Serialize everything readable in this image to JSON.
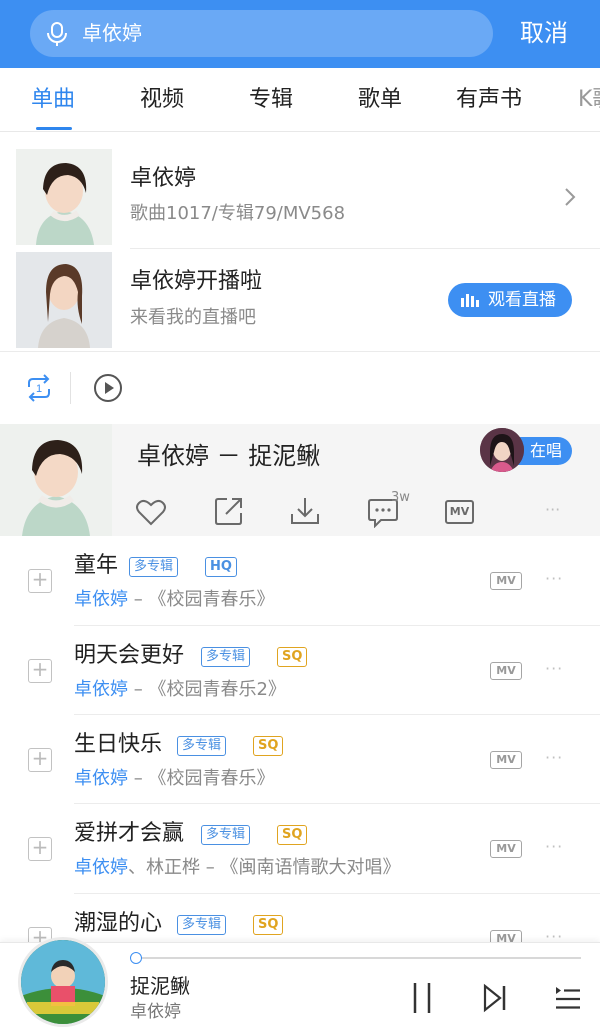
{
  "search": {
    "query": "卓依婷",
    "cancel_label": "取消"
  },
  "tabs": [
    {
      "label": "单曲",
      "active": true
    },
    {
      "label": "视频",
      "active": false
    },
    {
      "label": "专辑",
      "active": false
    },
    {
      "label": "歌单",
      "active": false
    },
    {
      "label": "有声书",
      "active": false
    },
    {
      "label": "K歌",
      "active": false
    }
  ],
  "artist_card": {
    "name": "卓依婷",
    "stats": "歌曲1017/专辑79/MV568"
  },
  "live_card": {
    "title": "卓依婷开播啦",
    "subtitle": "来看我的直播吧",
    "button": "观看直播"
  },
  "controls": {
    "loop_count": "1"
  },
  "now_playing": {
    "title": "卓依婷 － 捉泥鳅",
    "singing_label": "在唱",
    "comment_badge": "3w",
    "mv_label": "MV",
    "more": "···"
  },
  "songs": [
    {
      "name": "童年",
      "tags": [
        {
          "text": "多专辑",
          "type": "multi"
        },
        {
          "text": "HQ",
          "type": "hq"
        }
      ],
      "artist": "卓依婷",
      "album": " – 《校园青春乐》",
      "mv": "MV",
      "more": "···"
    },
    {
      "name": "明天会更好",
      "tags": [
        {
          "text": "多专辑",
          "type": "multi"
        },
        {
          "text": "SQ",
          "type": "sq"
        }
      ],
      "artist": "卓依婷",
      "album": " – 《校园青春乐2》",
      "mv": "MV",
      "more": "···"
    },
    {
      "name": "生日快乐",
      "tags": [
        {
          "text": "多专辑",
          "type": "multi"
        },
        {
          "text": "SQ",
          "type": "sq"
        }
      ],
      "artist": "卓依婷",
      "album": " – 《校园青春乐》",
      "mv": "MV",
      "more": "···"
    },
    {
      "name": "爱拼才会赢",
      "tags": [
        {
          "text": "多专辑",
          "type": "multi"
        },
        {
          "text": "SQ",
          "type": "sq"
        }
      ],
      "artist": "卓依婷",
      "album": "、林正桦 – 《闽南语情歌大对唱》",
      "mv": "MV",
      "more": "···"
    },
    {
      "name": "潮湿的心",
      "tags": [
        {
          "text": "多专辑",
          "type": "multi"
        },
        {
          "text": "SQ",
          "type": "sq"
        }
      ],
      "artist": "",
      "album": "",
      "mv": "MV",
      "more": "···"
    }
  ],
  "player": {
    "title": "捉泥鳅",
    "artist": "卓依婷",
    "progress": 0.0
  },
  "colors": {
    "accent": "#3d8ff2",
    "header_bg": "#3d8ff2",
    "sq": "#e0a420",
    "hq": "#4a90e2"
  }
}
